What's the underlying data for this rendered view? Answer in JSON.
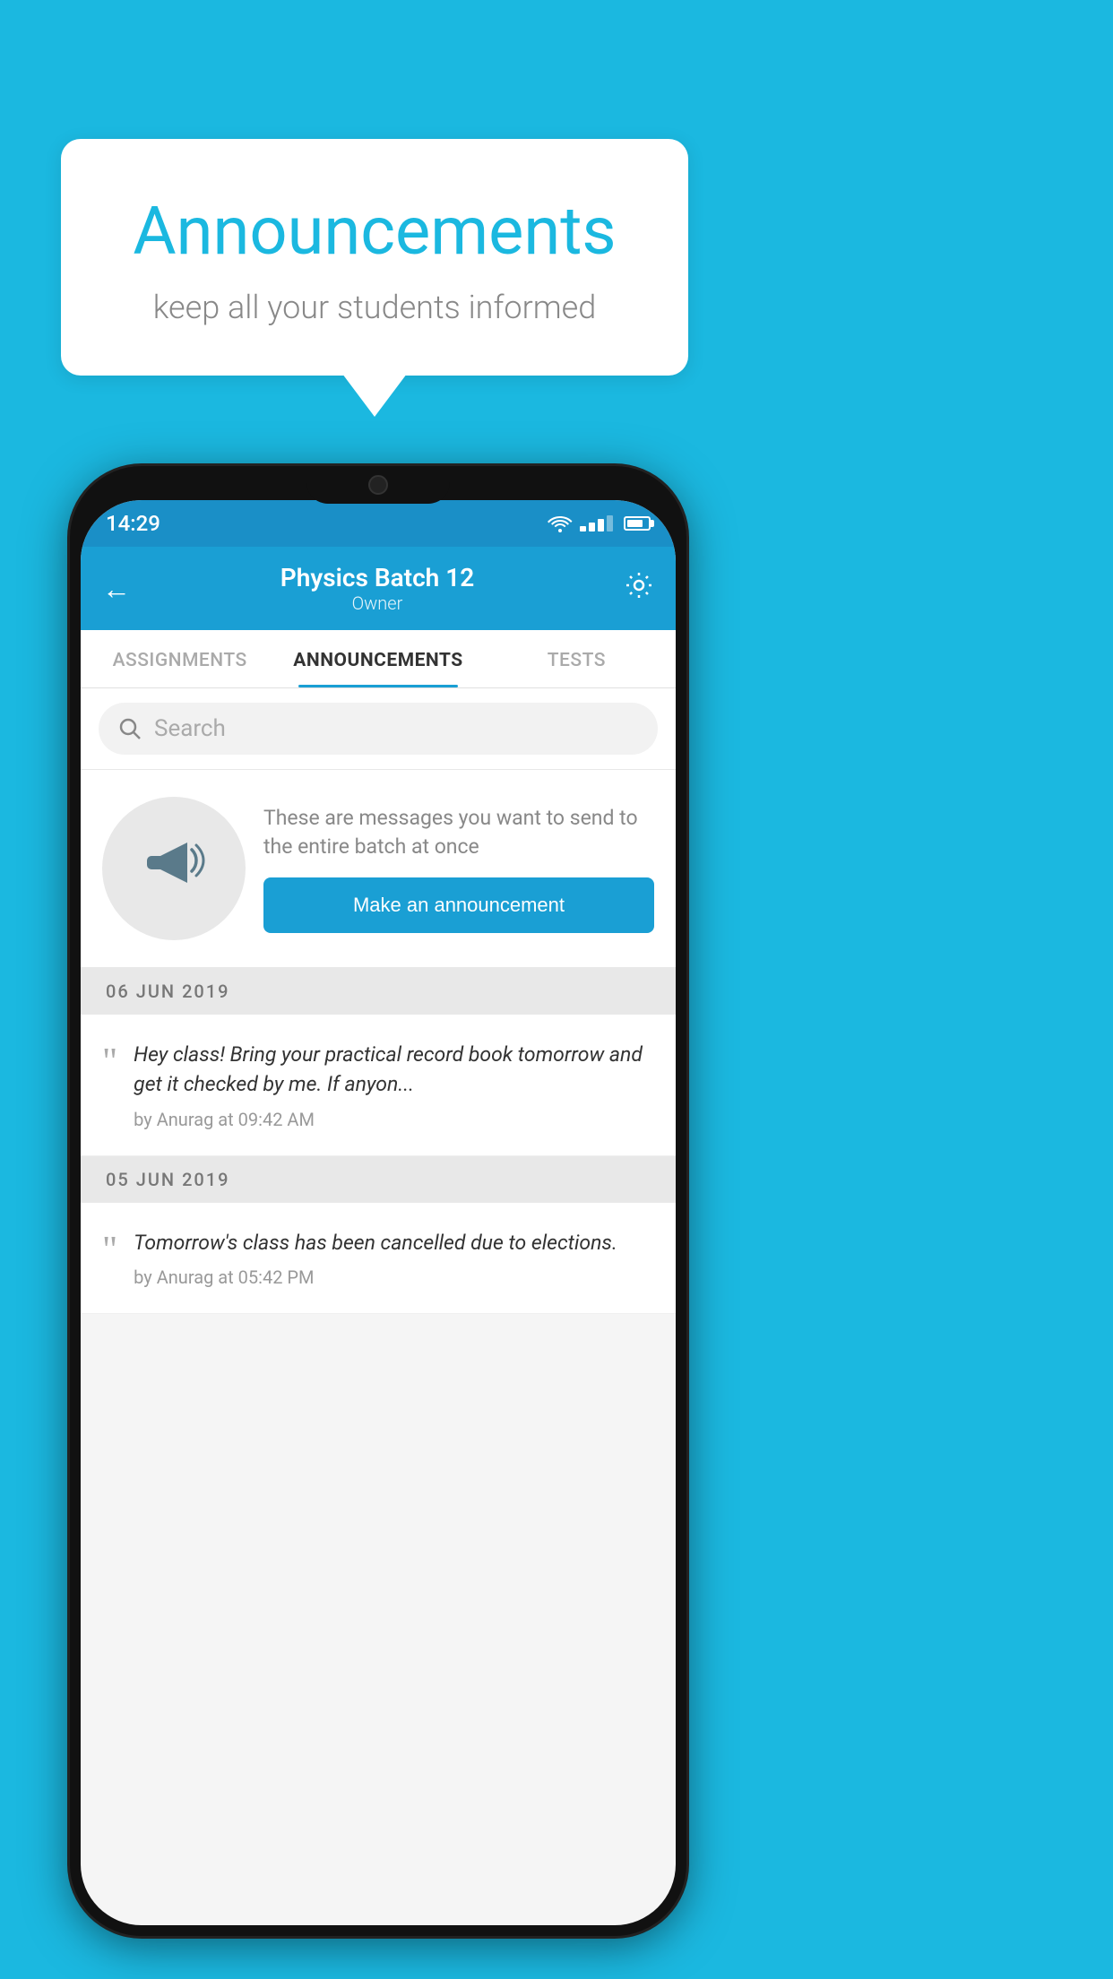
{
  "background_color": "#1bb8e0",
  "announcement_card": {
    "title": "Announcements",
    "subtitle": "keep all your students informed"
  },
  "phone": {
    "status_bar": {
      "time": "14:29"
    },
    "header": {
      "batch_name": "Physics Batch 12",
      "batch_role": "Owner",
      "back_label": "←",
      "settings_label": "⚙"
    },
    "tabs": [
      {
        "label": "ASSIGNMENTS",
        "active": false
      },
      {
        "label": "ANNOUNCEMENTS",
        "active": true
      },
      {
        "label": "TESTS",
        "active": false
      }
    ],
    "search": {
      "placeholder": "Search"
    },
    "announcement_prompt": {
      "description": "These are messages you want to send to the entire batch at once",
      "button_label": "Make an announcement"
    },
    "announcements": [
      {
        "date": "06  JUN  2019",
        "message": "Hey class! Bring your practical record book tomorrow and get it checked by me. If anyon...",
        "meta": "by Anurag at 09:42 AM"
      },
      {
        "date": "05  JUN  2019",
        "message": "Tomorrow's class has been cancelled due to elections.",
        "meta": "by Anurag at 05:42 PM"
      }
    ]
  }
}
